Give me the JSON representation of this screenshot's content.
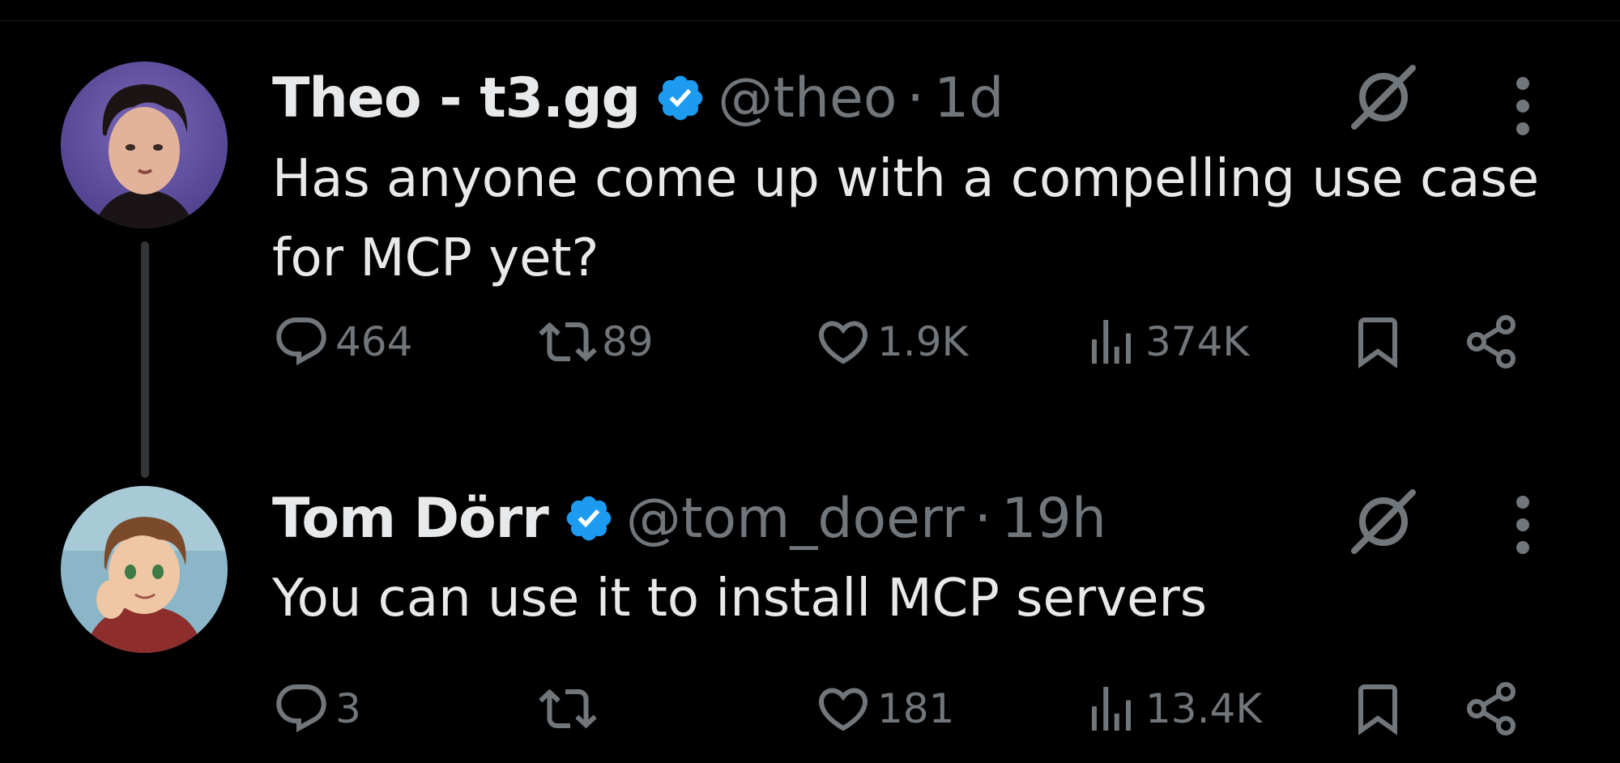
{
  "tweets": [
    {
      "author_name": "Theo - t3.gg",
      "handle": "@theo",
      "separator": "·",
      "time": "1d",
      "text": "Has anyone come up with a compelling use case for MCP yet?",
      "replies": "464",
      "retweets": "89",
      "likes": "1.9K",
      "views": "374K",
      "verified": true
    },
    {
      "author_name": "Tom Dörr",
      "handle": "@tom_doerr",
      "separator": "·",
      "time": "19h",
      "text": "You can use it to install MCP servers",
      "replies": "3",
      "retweets": "",
      "likes": "181",
      "views": "13.4K",
      "verified": true
    }
  ],
  "icons": {
    "reply": "reply-icon",
    "retweet": "retweet-icon",
    "like": "heart-icon",
    "views": "views-icon",
    "bookmark": "bookmark-icon",
    "share": "share-icon",
    "grok": "grok-icon",
    "more": "more-icon",
    "verified": "verified-badge-icon"
  },
  "colors": {
    "background": "#000000",
    "primary_text": "#e7e9ea",
    "secondary_text": "#71767b",
    "verified_blue": "#1d9bf0",
    "thread_line": "#333639"
  }
}
